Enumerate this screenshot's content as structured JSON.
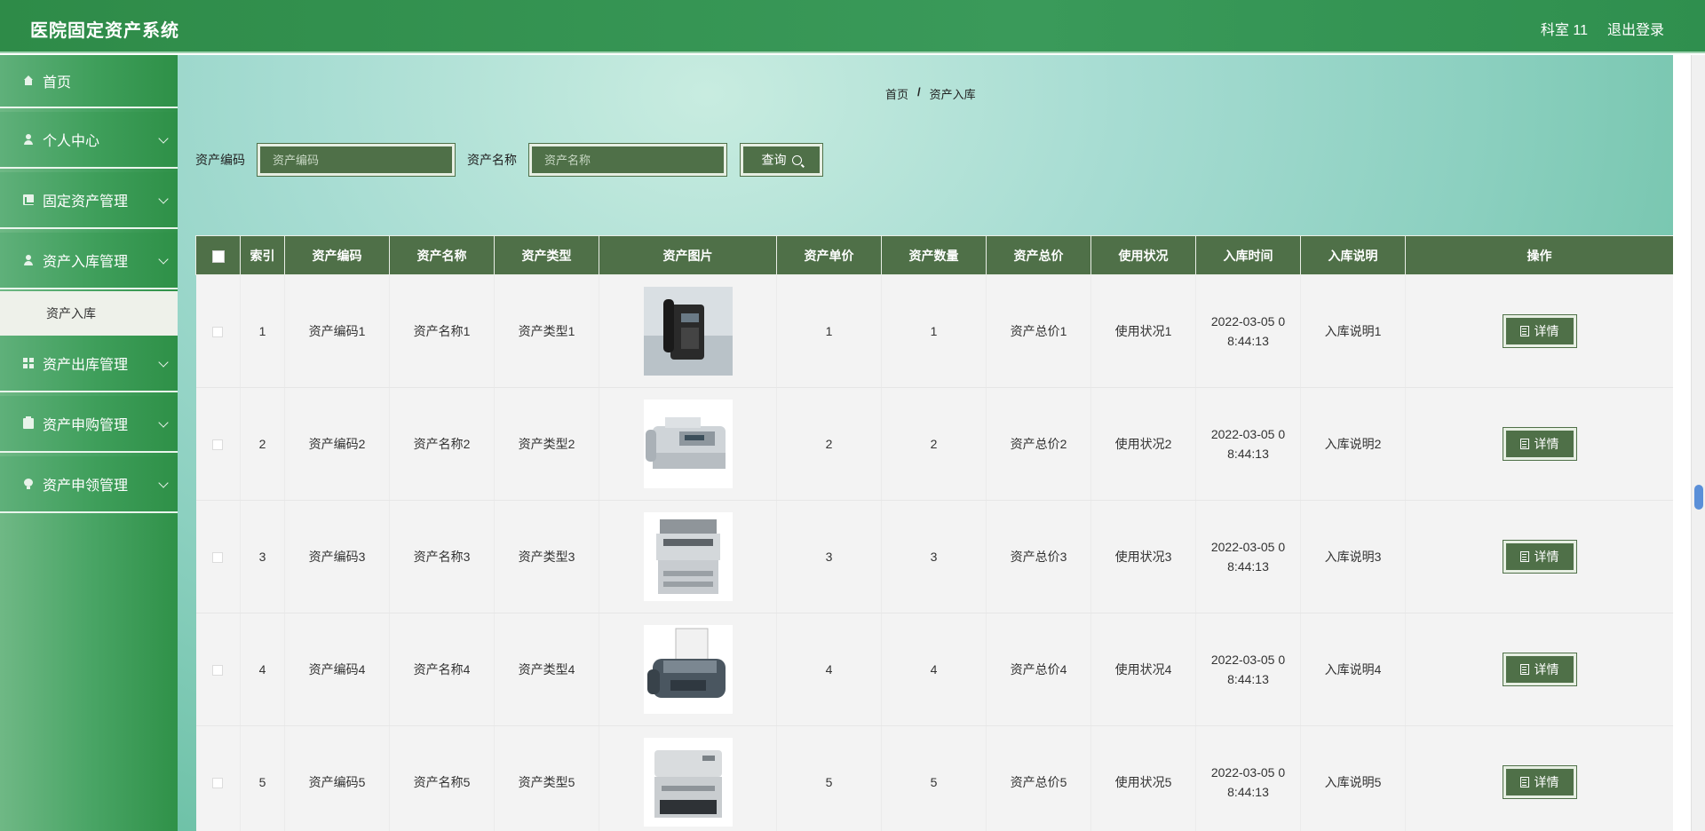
{
  "header": {
    "title": "医院固定资产系统",
    "user": "科室 11",
    "logout": "退出登录"
  },
  "sidebar": {
    "items": [
      {
        "label": "首页",
        "icon": "home-icon"
      },
      {
        "label": "个人中心",
        "icon": "user-icon"
      },
      {
        "label": "固定资产管理",
        "icon": "chart-icon"
      },
      {
        "label": "资产入库管理",
        "icon": "user-icon"
      },
      {
        "label": "资产出库管理",
        "icon": "grid-icon"
      },
      {
        "label": "资产申购管理",
        "icon": "clipboard-icon"
      },
      {
        "label": "资产申领管理",
        "icon": "bulb-icon"
      }
    ],
    "submenu": {
      "label": "资产入库"
    }
  },
  "breadcrumb": {
    "home": "首页",
    "sep": "/",
    "current": "资产入库"
  },
  "search": {
    "code_label": "资产编码",
    "code_placeholder": "资产编码",
    "name_label": "资产名称",
    "name_placeholder": "资产名称",
    "query_label": "查询"
  },
  "table": {
    "headers": [
      "索引",
      "资产编码",
      "资产名称",
      "资产类型",
      "资产图片",
      "资产单价",
      "资产数量",
      "资产总价",
      "使用状况",
      "入库时间",
      "入库说明",
      "操作"
    ],
    "detail_label": "详情",
    "rows": [
      {
        "index": "1",
        "code": "资产编码1",
        "name": "资产名称1",
        "type": "资产类型1",
        "image": "phone",
        "price": "1",
        "qty": "1",
        "total": "资产总价1",
        "status": "使用状况1",
        "time1": "2022-03-05 0",
        "time2": "8:44:13",
        "note": "入库说明1"
      },
      {
        "index": "2",
        "code": "资产编码2",
        "name": "资产名称2",
        "type": "资产类型2",
        "image": "fax",
        "price": "2",
        "qty": "2",
        "total": "资产总价2",
        "status": "使用状况2",
        "time1": "2022-03-05 0",
        "time2": "8:44:13",
        "note": "入库说明2"
      },
      {
        "index": "3",
        "code": "资产编码3",
        "name": "资产名称3",
        "type": "资产类型3",
        "image": "copier",
        "price": "3",
        "qty": "3",
        "total": "资产总价3",
        "status": "使用状况3",
        "time1": "2022-03-05 0",
        "time2": "8:44:13",
        "note": "入库说明3"
      },
      {
        "index": "4",
        "code": "资产编码4",
        "name": "资产名称4",
        "type": "资产类型4",
        "image": "fax-dark",
        "price": "4",
        "qty": "4",
        "total": "资产总价4",
        "status": "使用状况4",
        "time1": "2022-03-05 0",
        "time2": "8:44:13",
        "note": "入库说明4"
      },
      {
        "index": "5",
        "code": "资产编码5",
        "name": "资产名称5",
        "type": "资产类型5",
        "image": "printer",
        "price": "5",
        "qty": "5",
        "total": "资产总价5",
        "status": "使用状况5",
        "time1": "2022-03-05 0",
        "time2": "8:44:13",
        "note": "入库说明5"
      }
    ]
  },
  "colors": {
    "header": "#3a9a5a",
    "accent": "#4f7048",
    "row_bg": "#f3f3f3"
  }
}
